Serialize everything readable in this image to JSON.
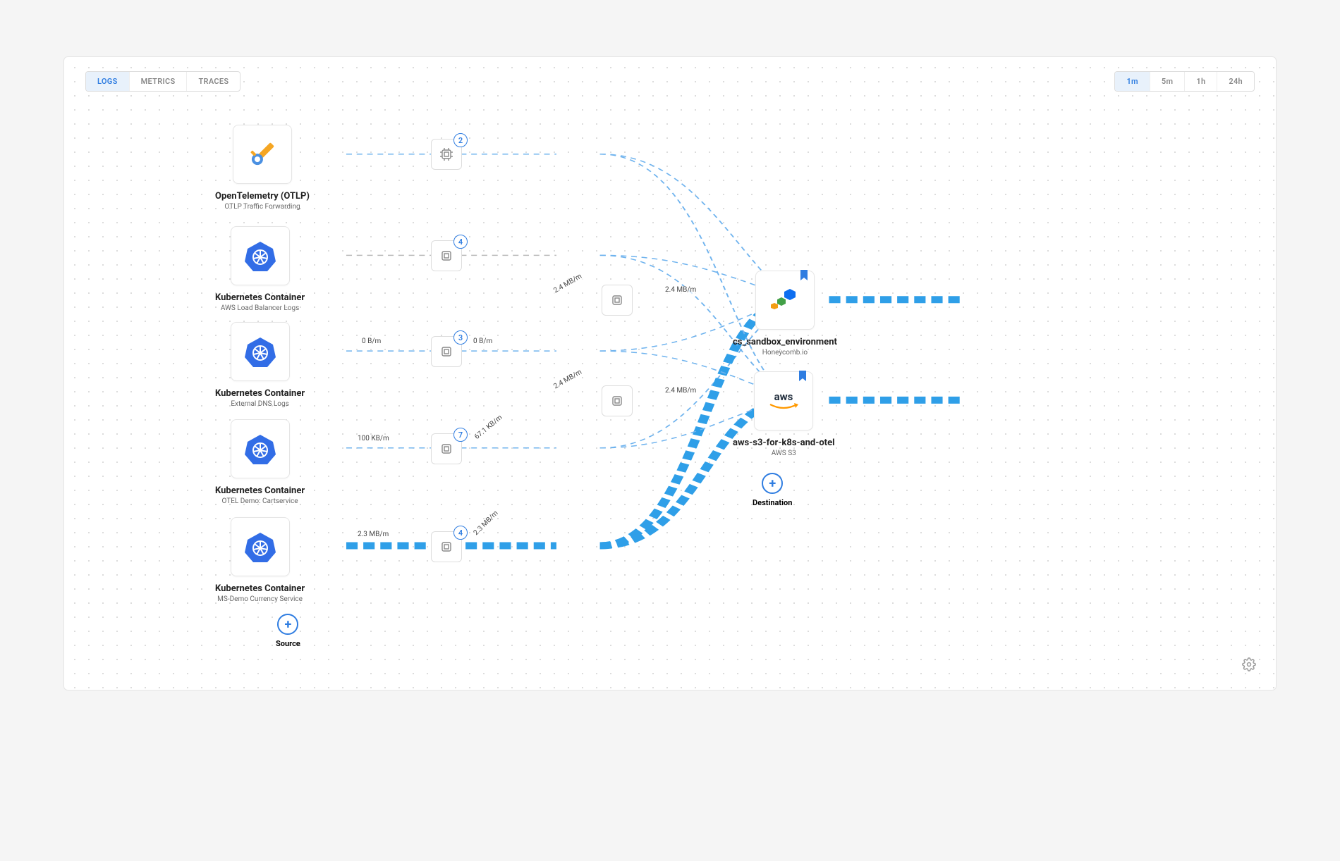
{
  "tabs": {
    "items": [
      "LOGS",
      "METRICS",
      "TRACES"
    ],
    "active": "LOGS"
  },
  "timerange": {
    "items": [
      "1m",
      "5m",
      "1h",
      "24h"
    ],
    "active": "1m"
  },
  "sources": [
    {
      "title": "OpenTelemetry (OTLP)",
      "subtitle": "OTLP Traffic Forwarding"
    },
    {
      "title": "Kubernetes Container",
      "subtitle": "AWS Load Balancer Logs"
    },
    {
      "title": "Kubernetes Container",
      "subtitle": "External DNS Logs"
    },
    {
      "title": "Kubernetes Container",
      "subtitle": "OTEL Demo: Cartservice"
    },
    {
      "title": "Kubernetes Container",
      "subtitle": "MS-Demo Currency Service"
    }
  ],
  "processors": [
    {
      "id": "p0",
      "badge": "2"
    },
    {
      "id": "p1",
      "badge": "4"
    },
    {
      "id": "p2",
      "badge": "3"
    },
    {
      "id": "p3",
      "badge": "7"
    },
    {
      "id": "p4",
      "badge": "4"
    },
    {
      "id": "pA",
      "badge": null
    },
    {
      "id": "pB",
      "badge": null
    }
  ],
  "destinations": [
    {
      "title": "cs_sandbox_environment",
      "subtitle": "Honeycomb.io",
      "bookmarked": true
    },
    {
      "title": "aws-s3-for-k8s-and-otel",
      "subtitle": "AWS S3",
      "bookmarked": true
    }
  ],
  "edge_labels": {
    "s2_p2": "0 B/m",
    "p2_out": "0 B/m",
    "s3_p3": "100 KB/m",
    "p3_out": "67.1 KB/m",
    "s4_p4": "2.3 MB/m",
    "p4_out": "2.3 MB/m",
    "pA_in": "2.4 MB/m",
    "pA_out": "2.4 MB/m",
    "pB_in": "2.4 MB/m",
    "pB_out": "2.4 MB/m"
  },
  "buttons": {
    "add_source": "Source",
    "add_dest": "Destination"
  }
}
